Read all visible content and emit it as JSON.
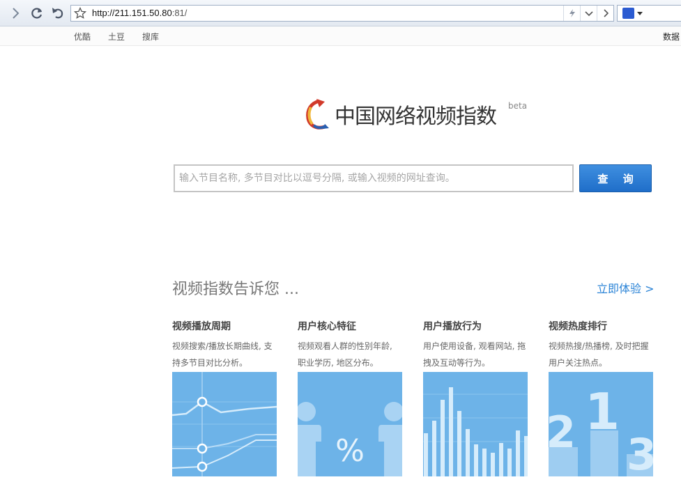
{
  "browser": {
    "url_main": "http://211.151.50.80",
    "url_port": ":81/",
    "bookmarks": [
      "优酷",
      "土豆",
      "搜库"
    ],
    "bookmark_right": "数据"
  },
  "logo": {
    "title": "中国网络视频指数",
    "badge": "beta"
  },
  "search": {
    "placeholder": "输入节目名称, 多节目对比以逗号分隔, 或输入视频的网址查询。",
    "button_label": "查 询"
  },
  "section": {
    "title": "视频指数告诉您 ...",
    "link": "立即体验 >"
  },
  "cards": [
    {
      "title": "视频播放周期",
      "desc": "视频搜索/播放长期曲线, 支持多节目对比分析。"
    },
    {
      "title": "用户核心特征",
      "desc": "视频观看人群的性别年龄, 职业学历, 地区分布。"
    },
    {
      "title": "用户播放行为",
      "desc": "用户使用设备, 观看网站, 拖拽及互动等行为。"
    },
    {
      "title": "视频热度排行",
      "desc": "视频热搜/热播榜, 及时把握用户关注热点。"
    }
  ],
  "card_art": {
    "percent_symbol": "%",
    "rank_digits": [
      "2",
      "1",
      "3"
    ]
  },
  "colors": {
    "accent": "#2a83d6",
    "card_bg": "#6db3e8",
    "button": "#2a7fd6"
  }
}
